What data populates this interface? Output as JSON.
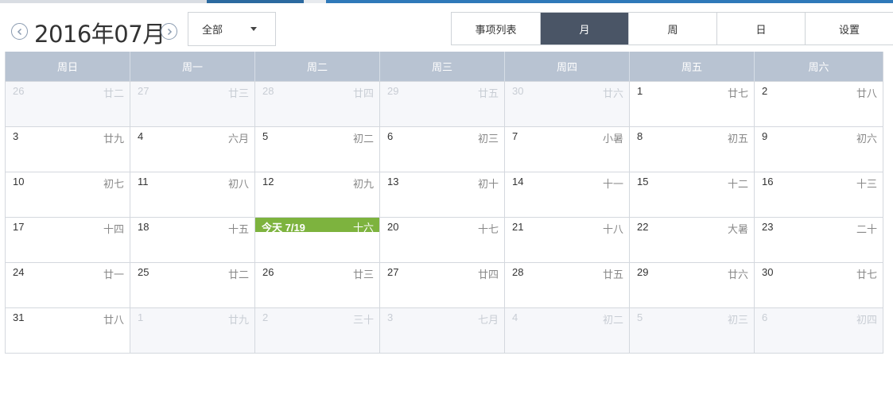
{
  "header": {
    "title": "2016年07月",
    "prev_icon": "chevron-left-circle-icon",
    "next_icon": "chevron-right-circle-icon",
    "filter_selected": "全部"
  },
  "view_tabs": [
    {
      "label": "事项列表",
      "active": false
    },
    {
      "label": "月",
      "active": true
    },
    {
      "label": "周",
      "active": false
    },
    {
      "label": "日",
      "active": false
    },
    {
      "label": "设置",
      "active": false
    }
  ],
  "weekdays": [
    "周日",
    "周一",
    "周二",
    "周三",
    "周四",
    "周五",
    "周六"
  ],
  "weeks": [
    [
      {
        "num": "26",
        "lunar": "廿二",
        "other": true
      },
      {
        "num": "27",
        "lunar": "廿三",
        "other": true
      },
      {
        "num": "28",
        "lunar": "廿四",
        "other": true
      },
      {
        "num": "29",
        "lunar": "廿五",
        "other": true
      },
      {
        "num": "30",
        "lunar": "廿六",
        "other": true
      },
      {
        "num": "1",
        "lunar": "廿七",
        "other": false
      },
      {
        "num": "2",
        "lunar": "廿八",
        "other": false
      }
    ],
    [
      {
        "num": "3",
        "lunar": "廿九",
        "other": false
      },
      {
        "num": "4",
        "lunar": "六月",
        "other": false
      },
      {
        "num": "5",
        "lunar": "初二",
        "other": false
      },
      {
        "num": "6",
        "lunar": "初三",
        "other": false
      },
      {
        "num": "7",
        "lunar": "小暑",
        "other": false
      },
      {
        "num": "8",
        "lunar": "初五",
        "other": false
      },
      {
        "num": "9",
        "lunar": "初六",
        "other": false
      }
    ],
    [
      {
        "num": "10",
        "lunar": "初七",
        "other": false
      },
      {
        "num": "11",
        "lunar": "初八",
        "other": false
      },
      {
        "num": "12",
        "lunar": "初九",
        "other": false
      },
      {
        "num": "13",
        "lunar": "初十",
        "other": false
      },
      {
        "num": "14",
        "lunar": "十一",
        "other": false
      },
      {
        "num": "15",
        "lunar": "十二",
        "other": false
      },
      {
        "num": "16",
        "lunar": "十三",
        "other": false
      }
    ],
    [
      {
        "num": "17",
        "lunar": "十四",
        "other": false
      },
      {
        "num": "18",
        "lunar": "十五",
        "other": false
      },
      {
        "num": "今天 7/19",
        "lunar": "十六",
        "other": false,
        "today": true
      },
      {
        "num": "20",
        "lunar": "十七",
        "other": false
      },
      {
        "num": "21",
        "lunar": "十八",
        "other": false
      },
      {
        "num": "22",
        "lunar": "大暑",
        "other": false
      },
      {
        "num": "23",
        "lunar": "二十",
        "other": false
      }
    ],
    [
      {
        "num": "24",
        "lunar": "廿一",
        "other": false
      },
      {
        "num": "25",
        "lunar": "廿二",
        "other": false
      },
      {
        "num": "26",
        "lunar": "廿三",
        "other": false
      },
      {
        "num": "27",
        "lunar": "廿四",
        "other": false
      },
      {
        "num": "28",
        "lunar": "廿五",
        "other": false
      },
      {
        "num": "29",
        "lunar": "廿六",
        "other": false
      },
      {
        "num": "30",
        "lunar": "廿七",
        "other": false
      }
    ],
    [
      {
        "num": "31",
        "lunar": "廿八",
        "other": false
      },
      {
        "num": "1",
        "lunar": "廿九",
        "other": true
      },
      {
        "num": "2",
        "lunar": "三十",
        "other": true
      },
      {
        "num": "3",
        "lunar": "七月",
        "other": true
      },
      {
        "num": "4",
        "lunar": "初二",
        "other": true
      },
      {
        "num": "5",
        "lunar": "初三",
        "other": true
      },
      {
        "num": "6",
        "lunar": "初四",
        "other": true
      }
    ]
  ],
  "colors": {
    "accent_dark": "#4a5566",
    "header_bg": "#b8c3d2",
    "today": "#7db33e",
    "other_month_bg": "#f6f7fa"
  }
}
